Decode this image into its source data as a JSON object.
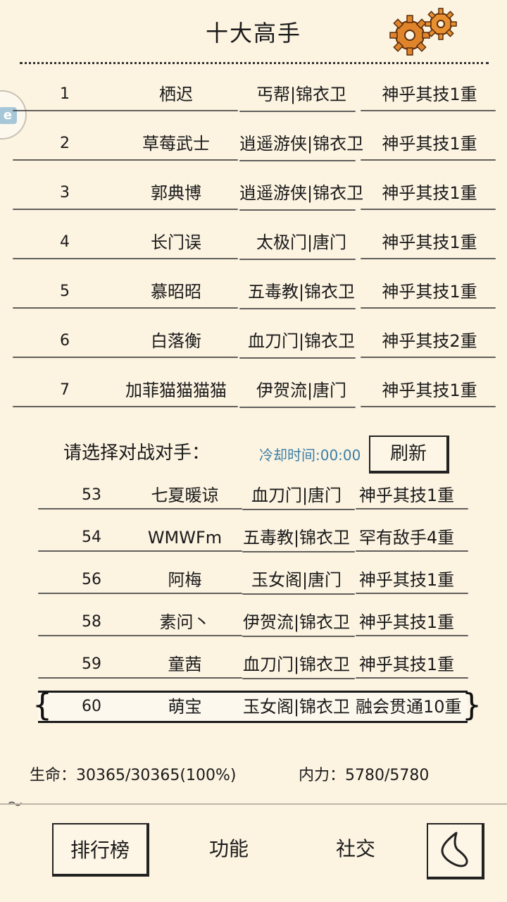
{
  "header": {
    "title": "十大高手",
    "settings_icon": "gear-icon"
  },
  "top_ranking": [
    {
      "rank": "1",
      "name": "栖迟",
      "sect": "丐帮|锦衣卫",
      "level": "神乎其技1重"
    },
    {
      "rank": "2",
      "name": "草莓武士",
      "sect": "逍遥游侠|锦衣卫",
      "level": "神乎其技1重"
    },
    {
      "rank": "3",
      "name": "郭典博",
      "sect": "逍遥游侠|锦衣卫",
      "level": "神乎其技1重"
    },
    {
      "rank": "4",
      "name": "长门误",
      "sect": "太极门|唐门",
      "level": "神乎其技1重"
    },
    {
      "rank": "5",
      "name": "慕昭昭",
      "sect": "五毒教|锦衣卫",
      "level": "神乎其技1重"
    },
    {
      "rank": "6",
      "name": "白落衡",
      "sect": "血刀门|锦衣卫",
      "level": "神乎其技2重"
    },
    {
      "rank": "7",
      "name": "加菲猫猫猫猫",
      "sect": "伊贺流|唐门",
      "level": "神乎其技1重"
    }
  ],
  "opponent_section": {
    "prompt": "请选择对战对手：",
    "cooldown": "冷却时间:00:00",
    "refresh_label": "刷新"
  },
  "opponents": [
    {
      "rank": "53",
      "name": "七夏暖谅",
      "sect": "血刀门|唐门",
      "level": "神乎其技1重"
    },
    {
      "rank": "54",
      "name": "WMWFm",
      "sect": "五毒教|锦衣卫",
      "level": "罕有敌手4重"
    },
    {
      "rank": "56",
      "name": "阿梅",
      "sect": "玉女阁|唐门",
      "level": "神乎其技1重"
    },
    {
      "rank": "58",
      "name": "素问丶",
      "sect": "伊贺流|锦衣卫",
      "level": "神乎其技1重"
    },
    {
      "rank": "59",
      "name": "童茜",
      "sect": "血刀门|锦衣卫",
      "level": "神乎其技1重"
    },
    {
      "rank": "60",
      "name": "萌宝",
      "sect": "玉女阁|锦衣卫",
      "level": "融会贯通10重"
    }
  ],
  "stats": {
    "hp": "生命：30365/30365(100%)",
    "mp": "内力：5780/5780"
  },
  "bottom_nav": {
    "ranking": "排行榜",
    "function": "功能",
    "social": "社交",
    "back_icon": "back-arrow-icon"
  },
  "side_tab_icon": "floating-app-icon",
  "colors": {
    "background": "#fcf3e1",
    "cooldown_text": "#3a7fa8",
    "gear": "#d9822b"
  }
}
